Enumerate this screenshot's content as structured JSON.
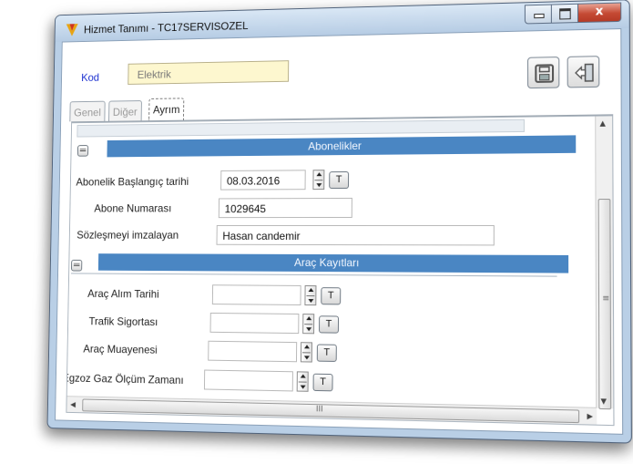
{
  "window": {
    "title": "Hizmet Tanımı - TC17SERVISOZEL",
    "close_glyph": "x"
  },
  "header": {
    "kod_label": "Kod",
    "kod_value": "Elektrik",
    "save_icon": "save-icon",
    "exit_icon": "exit-door-icon"
  },
  "tabs": [
    {
      "label": "Genel"
    },
    {
      "label": "Diğer"
    },
    {
      "label": "Ayrım",
      "active": true
    }
  ],
  "sections": {
    "abonelikler": {
      "title": "Abonelikler",
      "fields": {
        "baslangic": {
          "label": "Abonelik Başlangıç tarihi",
          "value": "08.03.2016",
          "t_button": "T"
        },
        "abone_no": {
          "label": "Abone Numarası",
          "value": "1029645"
        },
        "sozlesme": {
          "label": "Sözleşmeyi imzalayan",
          "value": "Hasan candemir"
        }
      }
    },
    "arac": {
      "title": "Araç Kayıtları",
      "fields": {
        "alim": {
          "label": "Araç Alım Tarihi",
          "value": "",
          "t_button": "T"
        },
        "sigorta": {
          "label": "Trafik Sigortası",
          "value": "",
          "t_button": "T"
        },
        "muayene": {
          "label": "Araç Muayenesi",
          "value": "",
          "t_button": "T"
        },
        "egzoz": {
          "label": "Egzoz Gaz Ölçüm Zamanı",
          "value": "",
          "t_button": "T"
        }
      }
    }
  },
  "scrollbars": {
    "h_grip": "III",
    "v_grip": "≡"
  },
  "colors": {
    "section_bar": "#4a86c3",
    "kod_label": "#1a2fd0",
    "kod_field_bg": "#fdf7cf"
  }
}
